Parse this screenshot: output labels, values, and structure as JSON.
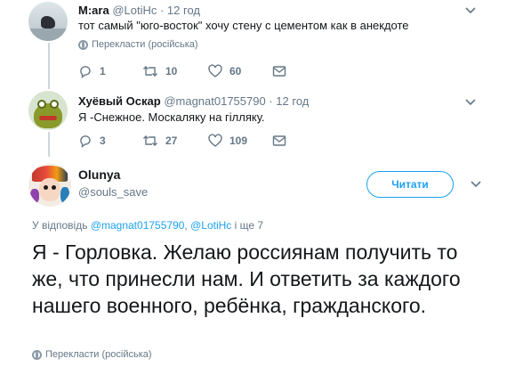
{
  "tweets": [
    {
      "name": "M:ara",
      "handle": "@LotiHc",
      "time": "· 12 год",
      "text": "тот самый \"юго-восток\" хочу стену с цементом как в анекдоте",
      "translate": "Перекласти (російська)",
      "replies": "1",
      "retweets": "10",
      "likes": "60"
    },
    {
      "name": "Хуёвый Оскар",
      "handle": "@magnat01755790",
      "time": "· 12 год",
      "text": "Я -Снежное. Москаляку на гілляку.",
      "replies": "3",
      "retweets": "27",
      "likes": "109"
    }
  ],
  "main": {
    "name": "Olunya",
    "handle": "@souls_save",
    "follow_label": "Читати",
    "reply_prefix": "У відповідь",
    "reply_user1": "@magnat01755790",
    "reply_sep": ",",
    "reply_user2": "@LotiHc",
    "reply_suffix": "і ще 7",
    "text": "Я - Горловка. Желаю россиянам получить то же, что принесли нам. И ответить за каждого нашего военного, ребёнка, гражданского.",
    "translate": "Перекласти (російська)"
  },
  "colors": {
    "accent": "#1da1f2",
    "muted": "#657786",
    "thread_line": "#ccd6dd"
  }
}
